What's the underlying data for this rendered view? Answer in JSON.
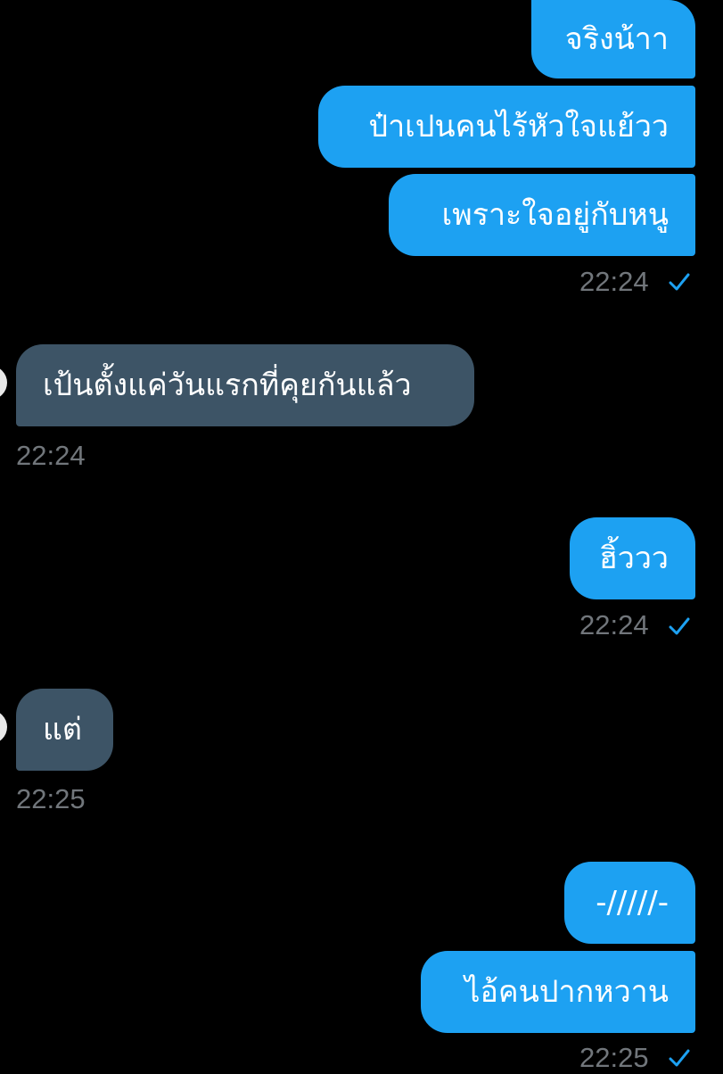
{
  "conversation": {
    "messages": [
      {
        "side": "out",
        "text": "จริงน้าา"
      },
      {
        "side": "out",
        "text": "ป๋าเปนคนไร้หัวใจแย้วว"
      },
      {
        "side": "out",
        "text": "เพราะใจอยู่กับหนู",
        "time": "22:24",
        "status": "sent-check-icon"
      },
      {
        "side": "in",
        "text": "เป้นตั้งแค่วันแรกที่คุยกันแล้ว",
        "time": "22:24"
      },
      {
        "side": "out",
        "text": "ฮิ้ววว",
        "time": "22:24",
        "status": "sent-check-icon"
      },
      {
        "side": "in",
        "text": "แต่",
        "time": "22:25"
      },
      {
        "side": "out",
        "text": "-/////-"
      },
      {
        "side": "out",
        "text": "ไอ้คนปากหวาน",
        "time": "22:25",
        "status": "sent-check-icon"
      }
    ]
  },
  "colors": {
    "background": "#000000",
    "outgoing_bubble": "#1da1f2",
    "incoming_bubble": "#3d5466",
    "timestamp": "#71767b",
    "check": "#1da1f2"
  }
}
